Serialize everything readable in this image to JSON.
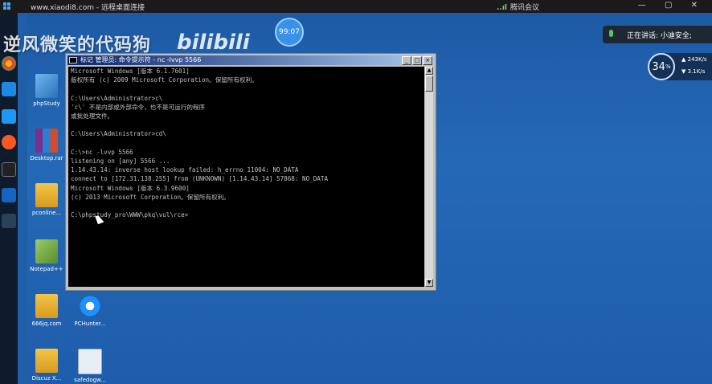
{
  "topbar": {
    "title": "www.xiaodi8.com - 远程桌面连接",
    "meeting": "腾讯会议",
    "signal": "..ıl"
  },
  "overlay": {
    "watermark": "逆风微笑的代码狗",
    "bili_logo": "bilibili",
    "timer": "99:07",
    "speaking": "正在讲话: 小迪安全;",
    "net_percent": "34",
    "net_percent_unit": "%",
    "net_up": "243K/s",
    "net_down": "3.1K/s"
  },
  "desktop_icons": [
    {
      "label": "phpStudy",
      "icon": "phpstudy-icon"
    },
    {
      "label": "Desktop.rar",
      "icon": "winrar-icon"
    },
    {
      "label": "pconline...",
      "icon": "folder-icon"
    },
    {
      "label": "Notepad++",
      "icon": "notepadpp-icon"
    },
    {
      "label": "666jq.com",
      "icon": "folder-icon"
    },
    {
      "label": "PCHunter...",
      "icon": "pchunter-icon"
    },
    {
      "label": "Discuz X...",
      "icon": "folder-icon"
    },
    {
      "label": "safedogw...",
      "icon": "safedog-icon"
    }
  ],
  "cmd": {
    "title": "标记 管理员: 命令提示符 - nc  -lvvp 5566",
    "lines": [
      "Microsoft Windows [版本 6.1.7601]",
      "版权所有 (c) 2009 Microsoft Corporation。保留所有权利。",
      "",
      "C:\\Users\\Administrator>c\\",
      "'c\\' 不是内部或外部命令，也不是可运行的程序",
      "或批处理文件。",
      "",
      "C:\\Users\\Administrator>cd\\",
      "",
      "C:\\>nc -lvvp 5566",
      "listening on [any] 5566 ...",
      "1.14.43.14: inverse host lookup failed: h_errno 11004: NO_DATA",
      "connect to [172.31.138.255] from (UNKNOWN) [1.14.43.14] 57868: NO_DATA",
      "Microsoft Windows [版本 6.3.9600]",
      "(c) 2013 Microsoft Corporation。保留所有权利。",
      "",
      "C:\\phpstudy_pro\\WWW\\pkq\\vul\\rce>"
    ]
  }
}
